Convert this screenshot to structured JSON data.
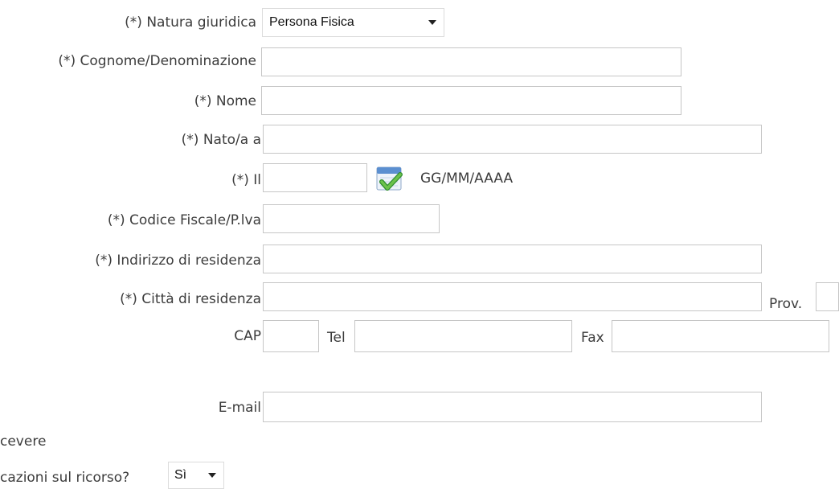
{
  "form": {
    "natura_giuridica": {
      "label": "(*) Natura giuridica",
      "selected": "Persona Fisica"
    },
    "cognome": {
      "label": "(*) Cognome/Denominazione",
      "value": ""
    },
    "nome": {
      "label": "(*) Nome",
      "value": ""
    },
    "nato_a": {
      "label": "(*) Nato/a a",
      "value": ""
    },
    "data_nascita": {
      "label": "(*) Il",
      "value": "",
      "format_hint": "GG/MM/AAAA",
      "icon": "calendar-icon"
    },
    "codice_fiscale": {
      "label": "(*) Codice Fiscale/P.lva",
      "value": ""
    },
    "indirizzo": {
      "label": "(*) Indirizzo di residenza",
      "value": ""
    },
    "citta": {
      "label": "(*) Città di residenza",
      "value": ""
    },
    "prov": {
      "label": "Prov.",
      "value": ""
    },
    "cap": {
      "label": "CAP",
      "value": ""
    },
    "tel": {
      "label": "Tel",
      "value": ""
    },
    "fax": {
      "label": "Fax",
      "value": ""
    },
    "email": {
      "label": "E-mail",
      "value": ""
    },
    "comunicazioni": {
      "label_line1": "cevere",
      "label_line2": "cazioni sul ricorso?",
      "selected": "Sì"
    }
  },
  "colors": {
    "label_text": "#3c3c3c",
    "field_border": "#c6c6c6",
    "calendar_check": "#4caa3c",
    "calendar_header": "#5b8fd0"
  }
}
